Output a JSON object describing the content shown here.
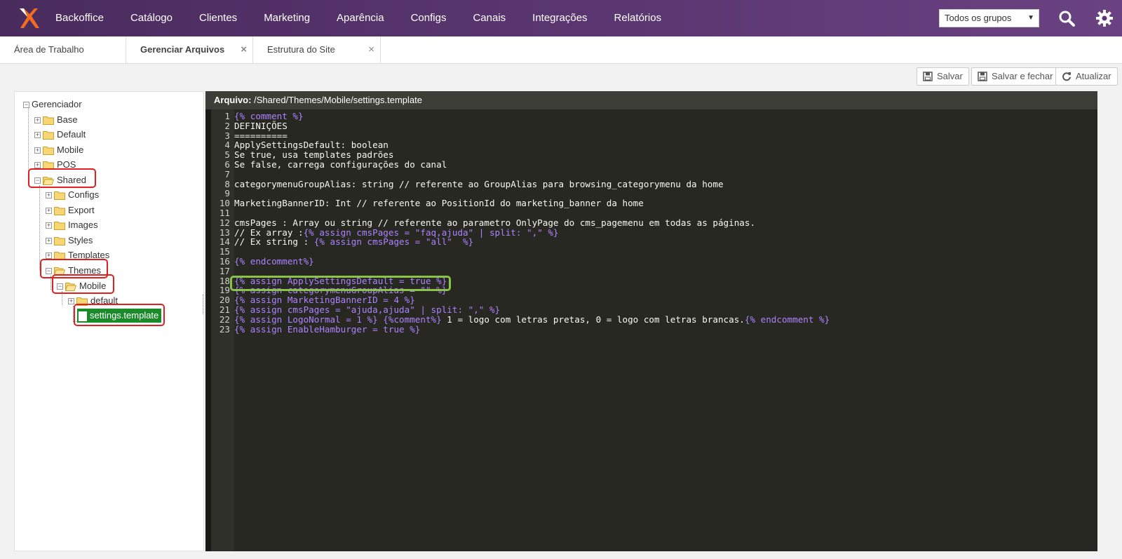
{
  "nav": {
    "items": [
      "Backoffice",
      "Catálogo",
      "Clientes",
      "Marketing",
      "Aparência",
      "Configs",
      "Canais",
      "Integrações",
      "Relatórios"
    ],
    "group_select": "Todos os grupos"
  },
  "tabs": [
    {
      "label": "Área de Trabalho"
    },
    {
      "label": "Gerenciar Arquivos",
      "close": "×"
    },
    {
      "label": "Estrutura do Site",
      "close": "×"
    }
  ],
  "toolbar": {
    "save": "Salvar",
    "save_close": "Salvar e fechar",
    "refresh": "Atualizar"
  },
  "tree": {
    "root": "Gerenciador",
    "top": [
      "Base",
      "Default",
      "Mobile",
      "POS",
      "Shared"
    ],
    "shared": [
      "Configs",
      "Export",
      "Images",
      "Styles",
      "Templates",
      "Themes"
    ],
    "themes": [
      "Mobile"
    ],
    "mobile": [
      "default"
    ],
    "file": "settings.template"
  },
  "editor": {
    "label": "Arquivo:",
    "path": "/Shared/Themes/Mobile/settings.template",
    "lines": [
      [
        {
          "c": "tag",
          "s": "{% comment %}"
        }
      ],
      [
        {
          "c": "t",
          "s": "DEFINIÇÕES"
        }
      ],
      [
        {
          "c": "t",
          "s": "=========="
        }
      ],
      [
        {
          "c": "t",
          "s": "ApplySettingsDefault: boolean"
        }
      ],
      [
        {
          "c": "t",
          "s": "Se true, usa templates padrões"
        }
      ],
      [
        {
          "c": "t",
          "s": "Se false, carrega configurações do canal"
        }
      ],
      [
        {
          "c": "t",
          "s": ""
        }
      ],
      [
        {
          "c": "t",
          "s": "categorymenuGroupAlias: string // referente ao GroupAlias para browsing_categorymenu da home"
        }
      ],
      [
        {
          "c": "t",
          "s": ""
        }
      ],
      [
        {
          "c": "t",
          "s": "MarketingBannerID: Int // referente ao PositionId do marketing_banner da home"
        }
      ],
      [
        {
          "c": "t",
          "s": ""
        }
      ],
      [
        {
          "c": "t",
          "s": "cmsPages : Array ou string // referente ao parametro OnlyPage do cms_pagemenu em todas as páginas."
        }
      ],
      [
        {
          "c": "t",
          "s": "// Ex array :"
        },
        {
          "c": "tag",
          "s": "{% assign cmsPages = \"faq,ajuda\" | split: \",\" %}"
        }
      ],
      [
        {
          "c": "t",
          "s": "// Ex string : "
        },
        {
          "c": "tag",
          "s": "{% assign cmsPages = \"all\"  %}"
        }
      ],
      [
        {
          "c": "t",
          "s": ""
        }
      ],
      [
        {
          "c": "tag",
          "s": "{% endcomment%}"
        }
      ],
      [
        {
          "c": "t",
          "s": ""
        }
      ],
      [
        {
          "c": "tag",
          "s": "{% assign ApplySettingsDefault = true %}"
        }
      ],
      [
        {
          "c": "tag",
          "s": "{% assign categorymenuGroupAlias = \"\" %}"
        }
      ],
      [
        {
          "c": "tag",
          "s": "{% assign MarketingBannerID = 4 %}"
        }
      ],
      [
        {
          "c": "tag",
          "s": "{% assign cmsPages = \"ajuda,ajuda\" | split: \",\" %}"
        }
      ],
      [
        {
          "c": "tag",
          "s": "{% assign LogoNormal = 1 %} {%comment%}"
        },
        {
          "c": "t",
          "s": " 1 = logo com letras pretas, 0 = logo com letras brancas."
        },
        {
          "c": "tag",
          "s": "{% endcomment %}"
        }
      ],
      [
        {
          "c": "tag",
          "s": "{% assign EnableHamburger = true %}"
        }
      ]
    ]
  }
}
